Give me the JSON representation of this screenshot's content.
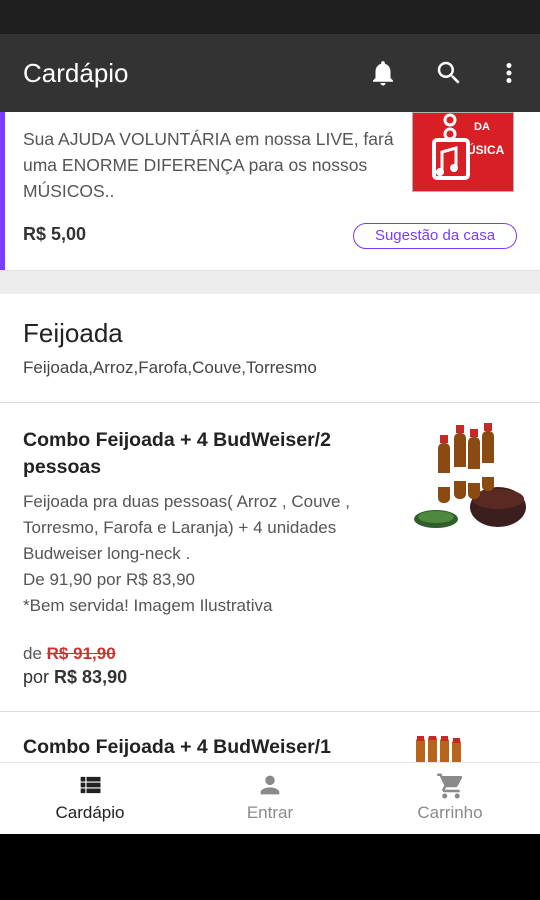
{
  "appbar": {
    "title": "Cardápio",
    "icons": [
      "bell-icon",
      "search-icon",
      "more-vert-icon"
    ]
  },
  "promo": {
    "description": "Sua AJUDA VOLUNTÁRIA em nossa LIVE, fará uma ENORME  DIFERENÇA para os nossos  MÚSICOS..",
    "price": "R$ 5,00",
    "badge": "Sugestão da casa",
    "image_text_top": "DA",
    "image_text_bottom": "ÚSICA",
    "accent": "#7a3cff"
  },
  "category": {
    "name": "Feijoada",
    "items": "Feijoada,Arroz,Farofa,Couve,Torresmo"
  },
  "products": [
    {
      "name": "Combo Feijoada + 4 BudWeiser/2 pessoas",
      "description": "Feijoada pra duas pessoas( Arroz , Couve , Torresmo, Farofa e Laranja) + 4 unidades Budweiser long-neck .\nDe 91,90 por R$ 83,90\n*Bem servida! Imagem Ilustrativa",
      "from_label": "de",
      "old_price": "R$ 91,90",
      "now_label": "por",
      "price": "R$ 83,90"
    },
    {
      "name": "Combo Feijoada + 4 BudWeiser/1"
    }
  ],
  "bottom_nav": [
    {
      "label": "Cardápio",
      "icon": "list-icon",
      "active": true
    },
    {
      "label": "Entrar",
      "icon": "person-icon",
      "active": false
    },
    {
      "label": "Carrinho",
      "icon": "cart-icon",
      "active": false
    }
  ],
  "colors": {
    "appbar": "#333333",
    "accent": "#7a3cff",
    "strike_price": "#d32f2f"
  }
}
